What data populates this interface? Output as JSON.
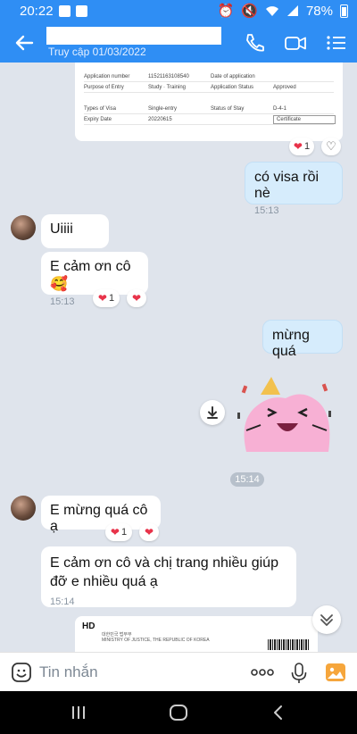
{
  "status_bar": {
    "time": "20:22",
    "battery": "78%"
  },
  "header": {
    "subtitle": "Truy cập 01/03/2022"
  },
  "document": {
    "rows": [
      [
        "Application number",
        "11521163108540",
        "Date of application",
        ""
      ],
      [
        "Purpose of Entry",
        "Study · Training",
        "Application Status",
        "Approved"
      ],
      [
        "",
        "",
        "",
        ""
      ],
      [
        "Types of Visa",
        "Single-entry",
        "Status of Stay",
        "D-4-1"
      ],
      [
        "Expiry Date",
        "20220615",
        "",
        "Certificate"
      ]
    ],
    "reaction_count": "1"
  },
  "messages": [
    {
      "text": "có visa rồi nè",
      "time": "15:13"
    },
    {
      "text": "Uiiii"
    },
    {
      "text": "E cảm ơn cô🥰",
      "time": "15:13",
      "reaction_count": "1"
    },
    {
      "text": "mừng quá"
    },
    {
      "text": "E mừng quá cô ạ",
      "reaction_count": "1"
    },
    {
      "text": "E cảm ơn cô và chị trang nhiều giúp đỡ e nhiều quá ạ",
      "time": "15:14"
    }
  ],
  "sticker_time": "15:14",
  "hd_card": {
    "label": "HD",
    "line1": "대한민국 법무부",
    "line2": "MINISTRY OF JUSTICE, THE REPUBLIC OF KOREA"
  },
  "input": {
    "placeholder": "Tin nhắn"
  },
  "colors": {
    "accent": "#2f8ef4",
    "my_bubble": "#d6ecfc",
    "heart": "#e8334a"
  }
}
